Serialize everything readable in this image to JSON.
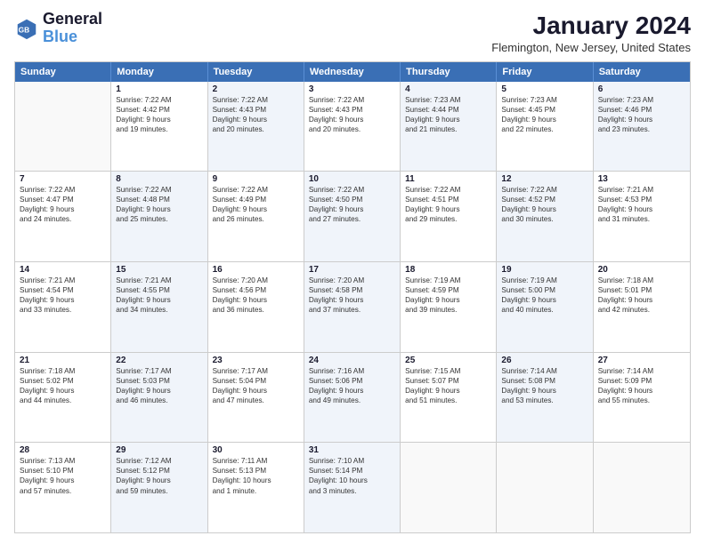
{
  "logo": {
    "line1": "General",
    "line2": "Blue"
  },
  "title": "January 2024",
  "subtitle": "Flemington, New Jersey, United States",
  "header_days": [
    "Sunday",
    "Monday",
    "Tuesday",
    "Wednesday",
    "Thursday",
    "Friday",
    "Saturday"
  ],
  "weeks": [
    [
      {
        "day": "",
        "lines": [],
        "shaded": false,
        "empty": true
      },
      {
        "day": "1",
        "lines": [
          "Sunrise: 7:22 AM",
          "Sunset: 4:42 PM",
          "Daylight: 9 hours",
          "and 19 minutes."
        ],
        "shaded": false,
        "empty": false
      },
      {
        "day": "2",
        "lines": [
          "Sunrise: 7:22 AM",
          "Sunset: 4:43 PM",
          "Daylight: 9 hours",
          "and 20 minutes."
        ],
        "shaded": true,
        "empty": false
      },
      {
        "day": "3",
        "lines": [
          "Sunrise: 7:22 AM",
          "Sunset: 4:43 PM",
          "Daylight: 9 hours",
          "and 20 minutes."
        ],
        "shaded": false,
        "empty": false
      },
      {
        "day": "4",
        "lines": [
          "Sunrise: 7:23 AM",
          "Sunset: 4:44 PM",
          "Daylight: 9 hours",
          "and 21 minutes."
        ],
        "shaded": true,
        "empty": false
      },
      {
        "day": "5",
        "lines": [
          "Sunrise: 7:23 AM",
          "Sunset: 4:45 PM",
          "Daylight: 9 hours",
          "and 22 minutes."
        ],
        "shaded": false,
        "empty": false
      },
      {
        "day": "6",
        "lines": [
          "Sunrise: 7:23 AM",
          "Sunset: 4:46 PM",
          "Daylight: 9 hours",
          "and 23 minutes."
        ],
        "shaded": true,
        "empty": false
      }
    ],
    [
      {
        "day": "7",
        "lines": [
          "Sunrise: 7:22 AM",
          "Sunset: 4:47 PM",
          "Daylight: 9 hours",
          "and 24 minutes."
        ],
        "shaded": false,
        "empty": false
      },
      {
        "day": "8",
        "lines": [
          "Sunrise: 7:22 AM",
          "Sunset: 4:48 PM",
          "Daylight: 9 hours",
          "and 25 minutes."
        ],
        "shaded": true,
        "empty": false
      },
      {
        "day": "9",
        "lines": [
          "Sunrise: 7:22 AM",
          "Sunset: 4:49 PM",
          "Daylight: 9 hours",
          "and 26 minutes."
        ],
        "shaded": false,
        "empty": false
      },
      {
        "day": "10",
        "lines": [
          "Sunrise: 7:22 AM",
          "Sunset: 4:50 PM",
          "Daylight: 9 hours",
          "and 27 minutes."
        ],
        "shaded": true,
        "empty": false
      },
      {
        "day": "11",
        "lines": [
          "Sunrise: 7:22 AM",
          "Sunset: 4:51 PM",
          "Daylight: 9 hours",
          "and 29 minutes."
        ],
        "shaded": false,
        "empty": false
      },
      {
        "day": "12",
        "lines": [
          "Sunrise: 7:22 AM",
          "Sunset: 4:52 PM",
          "Daylight: 9 hours",
          "and 30 minutes."
        ],
        "shaded": true,
        "empty": false
      },
      {
        "day": "13",
        "lines": [
          "Sunrise: 7:21 AM",
          "Sunset: 4:53 PM",
          "Daylight: 9 hours",
          "and 31 minutes."
        ],
        "shaded": false,
        "empty": false
      }
    ],
    [
      {
        "day": "14",
        "lines": [
          "Sunrise: 7:21 AM",
          "Sunset: 4:54 PM",
          "Daylight: 9 hours",
          "and 33 minutes."
        ],
        "shaded": false,
        "empty": false
      },
      {
        "day": "15",
        "lines": [
          "Sunrise: 7:21 AM",
          "Sunset: 4:55 PM",
          "Daylight: 9 hours",
          "and 34 minutes."
        ],
        "shaded": true,
        "empty": false
      },
      {
        "day": "16",
        "lines": [
          "Sunrise: 7:20 AM",
          "Sunset: 4:56 PM",
          "Daylight: 9 hours",
          "and 36 minutes."
        ],
        "shaded": false,
        "empty": false
      },
      {
        "day": "17",
        "lines": [
          "Sunrise: 7:20 AM",
          "Sunset: 4:58 PM",
          "Daylight: 9 hours",
          "and 37 minutes."
        ],
        "shaded": true,
        "empty": false
      },
      {
        "day": "18",
        "lines": [
          "Sunrise: 7:19 AM",
          "Sunset: 4:59 PM",
          "Daylight: 9 hours",
          "and 39 minutes."
        ],
        "shaded": false,
        "empty": false
      },
      {
        "day": "19",
        "lines": [
          "Sunrise: 7:19 AM",
          "Sunset: 5:00 PM",
          "Daylight: 9 hours",
          "and 40 minutes."
        ],
        "shaded": true,
        "empty": false
      },
      {
        "day": "20",
        "lines": [
          "Sunrise: 7:18 AM",
          "Sunset: 5:01 PM",
          "Daylight: 9 hours",
          "and 42 minutes."
        ],
        "shaded": false,
        "empty": false
      }
    ],
    [
      {
        "day": "21",
        "lines": [
          "Sunrise: 7:18 AM",
          "Sunset: 5:02 PM",
          "Daylight: 9 hours",
          "and 44 minutes."
        ],
        "shaded": false,
        "empty": false
      },
      {
        "day": "22",
        "lines": [
          "Sunrise: 7:17 AM",
          "Sunset: 5:03 PM",
          "Daylight: 9 hours",
          "and 46 minutes."
        ],
        "shaded": true,
        "empty": false
      },
      {
        "day": "23",
        "lines": [
          "Sunrise: 7:17 AM",
          "Sunset: 5:04 PM",
          "Daylight: 9 hours",
          "and 47 minutes."
        ],
        "shaded": false,
        "empty": false
      },
      {
        "day": "24",
        "lines": [
          "Sunrise: 7:16 AM",
          "Sunset: 5:06 PM",
          "Daylight: 9 hours",
          "and 49 minutes."
        ],
        "shaded": true,
        "empty": false
      },
      {
        "day": "25",
        "lines": [
          "Sunrise: 7:15 AM",
          "Sunset: 5:07 PM",
          "Daylight: 9 hours",
          "and 51 minutes."
        ],
        "shaded": false,
        "empty": false
      },
      {
        "day": "26",
        "lines": [
          "Sunrise: 7:14 AM",
          "Sunset: 5:08 PM",
          "Daylight: 9 hours",
          "and 53 minutes."
        ],
        "shaded": true,
        "empty": false
      },
      {
        "day": "27",
        "lines": [
          "Sunrise: 7:14 AM",
          "Sunset: 5:09 PM",
          "Daylight: 9 hours",
          "and 55 minutes."
        ],
        "shaded": false,
        "empty": false
      }
    ],
    [
      {
        "day": "28",
        "lines": [
          "Sunrise: 7:13 AM",
          "Sunset: 5:10 PM",
          "Daylight: 9 hours",
          "and 57 minutes."
        ],
        "shaded": false,
        "empty": false
      },
      {
        "day": "29",
        "lines": [
          "Sunrise: 7:12 AM",
          "Sunset: 5:12 PM",
          "Daylight: 9 hours",
          "and 59 minutes."
        ],
        "shaded": true,
        "empty": false
      },
      {
        "day": "30",
        "lines": [
          "Sunrise: 7:11 AM",
          "Sunset: 5:13 PM",
          "Daylight: 10 hours",
          "and 1 minute."
        ],
        "shaded": false,
        "empty": false
      },
      {
        "day": "31",
        "lines": [
          "Sunrise: 7:10 AM",
          "Sunset: 5:14 PM",
          "Daylight: 10 hours",
          "and 3 minutes."
        ],
        "shaded": true,
        "empty": false
      },
      {
        "day": "",
        "lines": [],
        "shaded": false,
        "empty": true
      },
      {
        "day": "",
        "lines": [],
        "shaded": false,
        "empty": true
      },
      {
        "day": "",
        "lines": [],
        "shaded": false,
        "empty": true
      }
    ]
  ]
}
